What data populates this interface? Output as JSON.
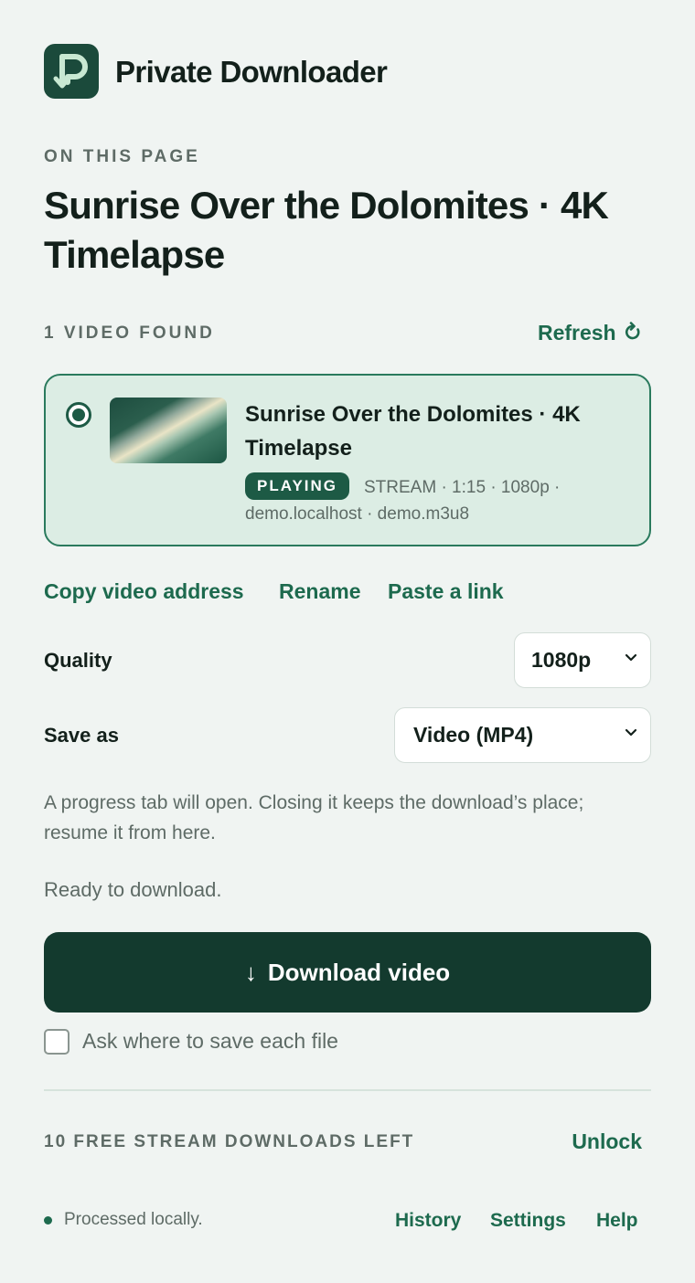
{
  "app": {
    "title": "Private Downloader"
  },
  "page": {
    "eyebrow": "ON THIS PAGE",
    "title": "Sunrise Over the Dolomites · 4K Timelapse"
  },
  "videos": {
    "count_label": "1 VIDEO FOUND",
    "refresh_label": "Refresh",
    "items": [
      {
        "title": "Sunrise Over the Dolomites · 4K Timelapse",
        "badge": "PLAYING",
        "meta": "STREAM · 1:15 · 1080p · demo.localhost · demo.m3u8",
        "selected": true
      }
    ]
  },
  "actions": {
    "copy": "Copy video address",
    "rename": "Rename",
    "paste": "Paste a link"
  },
  "quality": {
    "label": "Quality",
    "value": "1080p"
  },
  "save_as": {
    "label": "Save as",
    "value": "Video (MP4)"
  },
  "note": "A progress tab will open. Closing it keeps the download’s place; resume it from here.",
  "status": "Ready to download.",
  "download": {
    "arrow": "↓",
    "label": "Download video"
  },
  "ask_where": {
    "label": "Ask where to save each file",
    "checked": false
  },
  "quota": {
    "label": "10 FREE STREAM DOWNLOADS LEFT",
    "unlock": "Unlock"
  },
  "footer": {
    "local": "Processed locally.",
    "history": "History",
    "settings": "Settings",
    "help": "Help"
  },
  "colors": {
    "accent": "#1d6a4e",
    "brand_dark": "#133a2e",
    "card_bg": "#dcede4",
    "page_bg": "#f0f4f2"
  },
  "icons": [
    "download-logo-icon",
    "refresh-icon",
    "chevron-down-icon",
    "download-arrow-icon"
  ]
}
